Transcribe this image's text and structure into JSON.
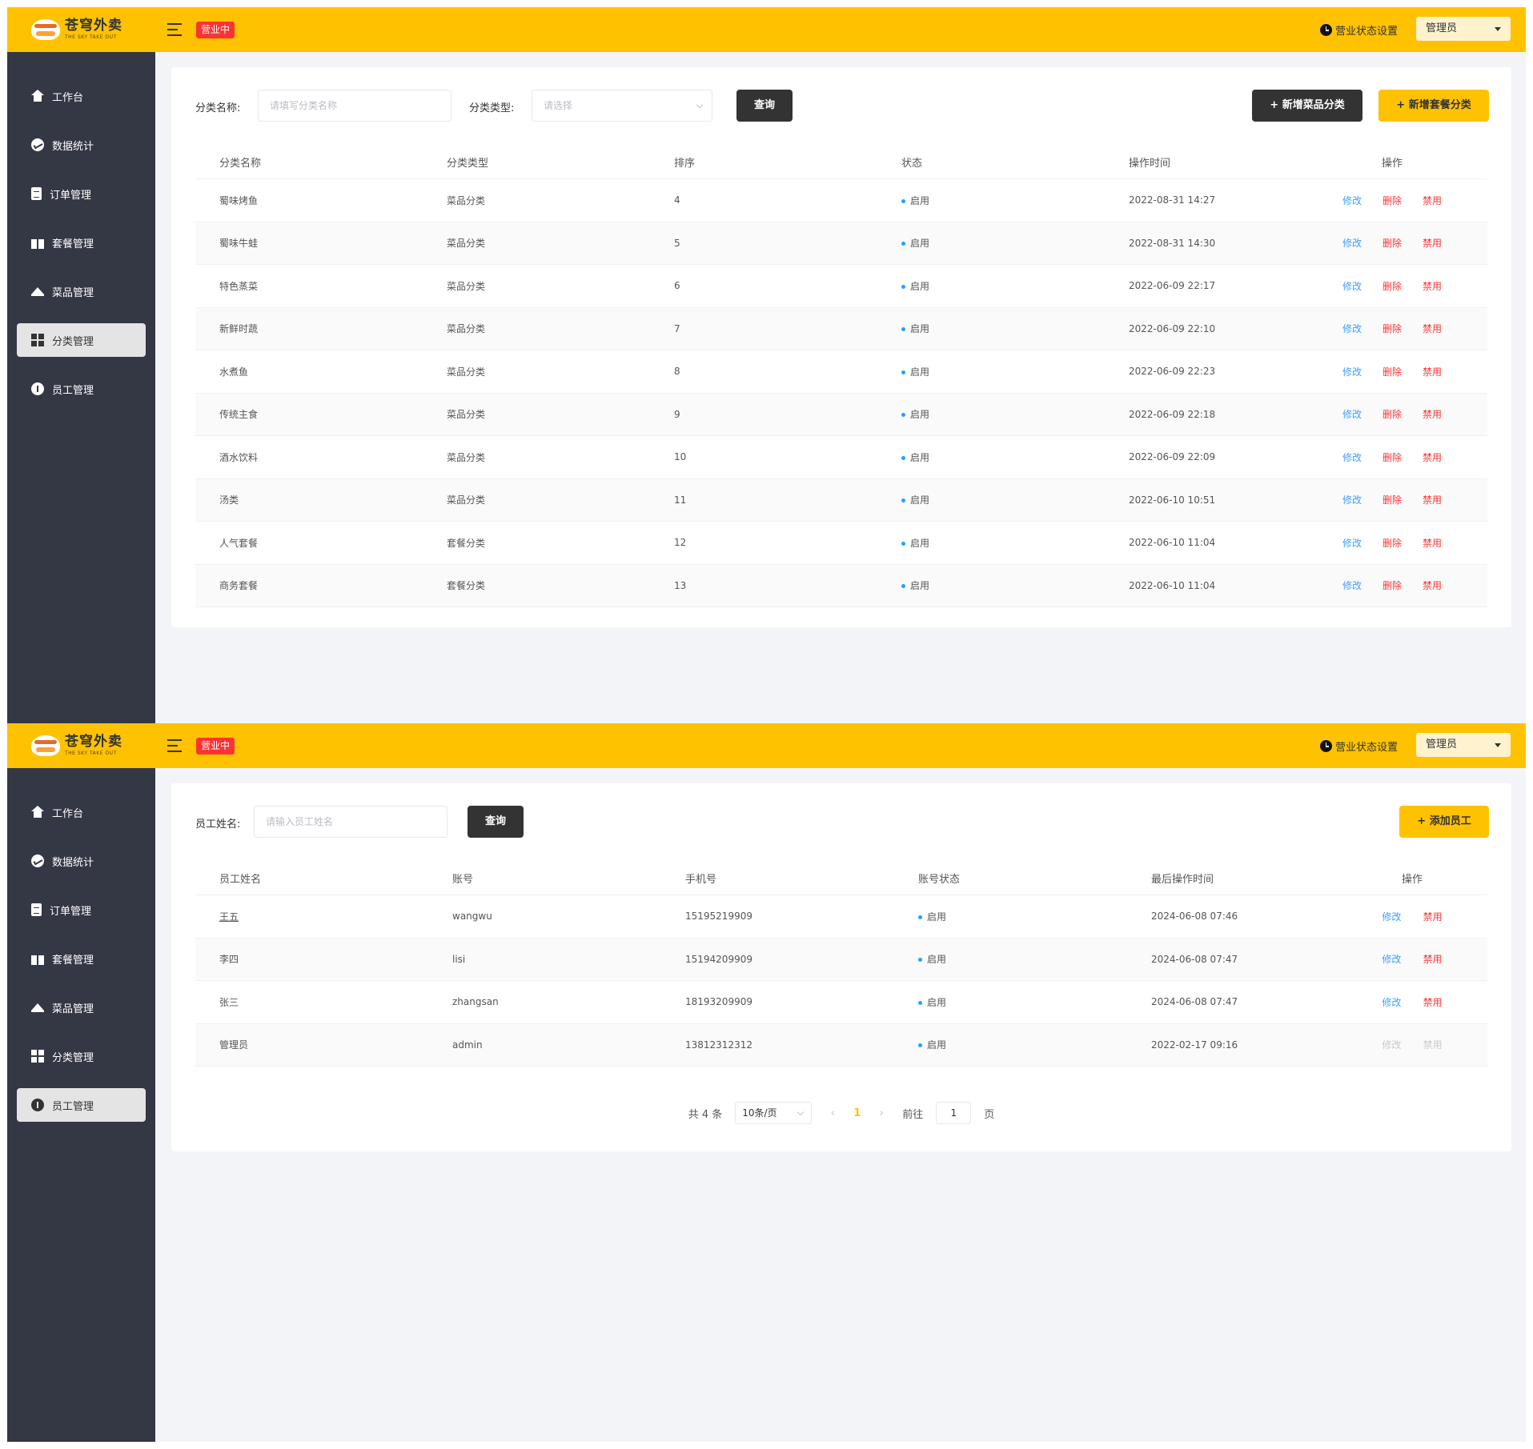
{
  "header": {
    "brand_cn": "苍穹外卖",
    "brand_en": "THE SKY TAKE OUT",
    "status_tag": "营业中",
    "store_setting": "营业状态设置",
    "user": "管理员"
  },
  "sidebar": {
    "items": [
      {
        "label": "工作台",
        "icon": "home-icon"
      },
      {
        "label": "数据统计",
        "icon": "chart-icon"
      },
      {
        "label": "订单管理",
        "icon": "order-icon"
      },
      {
        "label": "套餐管理",
        "icon": "gift-icon"
      },
      {
        "label": "菜品管理",
        "icon": "dish-icon"
      },
      {
        "label": "分类管理",
        "icon": "grid-icon"
      },
      {
        "label": "员工管理",
        "icon": "info-icon"
      }
    ]
  },
  "category_page": {
    "active_nav": "分类管理",
    "filter": {
      "name_label": "分类名称:",
      "name_placeholder": "请填写分类名称",
      "type_label": "分类类型:",
      "type_placeholder": "请选择",
      "query_button": "查询",
      "add_dish_category_button": "+ 新增菜品分类",
      "add_combo_category_button": "+ 新增套餐分类"
    },
    "columns": [
      "分类名称",
      "分类类型",
      "排序",
      "状态",
      "操作时间",
      "操作"
    ],
    "actions": {
      "edit": "修改",
      "delete": "删除",
      "disable": "禁用"
    },
    "rows": [
      {
        "name": "蜀味烤鱼",
        "type": "菜品分类",
        "sort": "4",
        "status": "启用",
        "time": "2022-08-31 14:27"
      },
      {
        "name": "蜀味牛蛙",
        "type": "菜品分类",
        "sort": "5",
        "status": "启用",
        "time": "2022-08-31 14:30"
      },
      {
        "name": "特色蒸菜",
        "type": "菜品分类",
        "sort": "6",
        "status": "启用",
        "time": "2022-06-09 22:17"
      },
      {
        "name": "新鲜时蔬",
        "type": "菜品分类",
        "sort": "7",
        "status": "启用",
        "time": "2022-06-09 22:10"
      },
      {
        "name": "水煮鱼",
        "type": "菜品分类",
        "sort": "8",
        "status": "启用",
        "time": "2022-06-09 22:23"
      },
      {
        "name": "传统主食",
        "type": "菜品分类",
        "sort": "9",
        "status": "启用",
        "time": "2022-06-09 22:18"
      },
      {
        "name": "酒水饮料",
        "type": "菜品分类",
        "sort": "10",
        "status": "启用",
        "time": "2022-06-09 22:09"
      },
      {
        "name": "汤类",
        "type": "菜品分类",
        "sort": "11",
        "status": "启用",
        "time": "2022-06-10 10:51"
      },
      {
        "name": "人气套餐",
        "type": "套餐分类",
        "sort": "12",
        "status": "启用",
        "time": "2022-06-10 11:04"
      },
      {
        "name": "商务套餐",
        "type": "套餐分类",
        "sort": "13",
        "status": "启用",
        "time": "2022-06-10 11:04"
      }
    ]
  },
  "employee_page": {
    "active_nav": "员工管理",
    "filter": {
      "name_label": "员工姓名:",
      "name_placeholder": "请输入员工姓名",
      "query_button": "查询",
      "add_button": "+ 添加员工"
    },
    "columns": [
      "员工姓名",
      "账号",
      "手机号",
      "账号状态",
      "最后操作时间",
      "操作"
    ],
    "actions": {
      "edit": "修改",
      "disable": "禁用"
    },
    "rows": [
      {
        "name": "王五",
        "account": "wangwu",
        "phone": "15195219909",
        "status": "启用",
        "time": "2024-06-08 07:46",
        "actions_enabled": true
      },
      {
        "name": "李四",
        "account": "lisi",
        "phone": "15194209909",
        "status": "启用",
        "time": "2024-06-08 07:47",
        "actions_enabled": true
      },
      {
        "name": "张三",
        "account": "zhangsan",
        "phone": "18193209909",
        "status": "启用",
        "time": "2024-06-08 07:47",
        "actions_enabled": true
      },
      {
        "name": "管理员",
        "account": "admin",
        "phone": "13812312312",
        "status": "启用",
        "time": "2022-02-17 09:16",
        "actions_enabled": false
      }
    ],
    "pagination": {
      "total": "共 4 条",
      "page_size": "10条/页",
      "current_page": "1",
      "goto_label": "前往",
      "goto_value": "1",
      "page_suffix": "页"
    }
  }
}
